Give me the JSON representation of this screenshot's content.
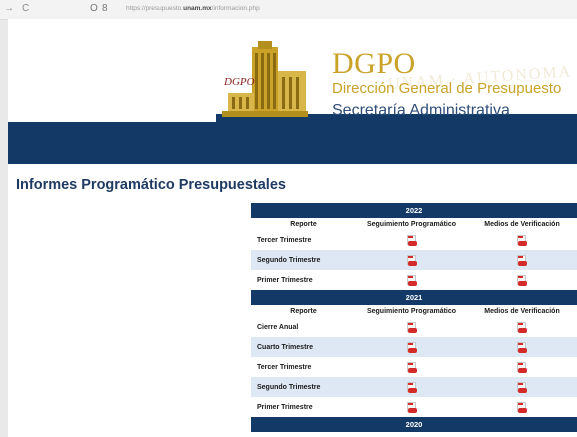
{
  "browser": {
    "back_icon": "→",
    "reload_icon": "C",
    "shield_icon": "O",
    "lock_icon": "8",
    "url_prefix": "https://presupuesto.",
    "url_domain": "unam.mx",
    "url_suffix": "/informacion.php"
  },
  "header": {
    "logo_text": "DGPO",
    "acronym": "DGPO",
    "name": "Dirección General de Presupuesto",
    "secretaria": "Secretaría Administrativa",
    "watermark": "UNAM · AUTONOMA D"
  },
  "page": {
    "title": "Informes Programático Presupuestales"
  },
  "table": {
    "headers": [
      "Reporte",
      "Seguimiento Programático",
      "Medios de Verificación"
    ],
    "years": [
      {
        "year": "2022",
        "rows": [
          "Tercer Trimestre",
          "Segundo Trimestre",
          "Primer Trimestre"
        ]
      },
      {
        "year": "2021",
        "rows": [
          "Cierre Anual",
          "Cuarto Trimestre",
          "Tercer Trimestre",
          "Segundo Trimestre",
          "Primer Trimestre"
        ]
      },
      {
        "year": "2020",
        "rows": []
      }
    ]
  },
  "colors": {
    "navy": "#133a66",
    "gold": "#c9a227",
    "row_alt": "#dde8f4",
    "pdf_red": "#d42a2a"
  },
  "icons": {
    "document": "pdf-file-icon"
  }
}
